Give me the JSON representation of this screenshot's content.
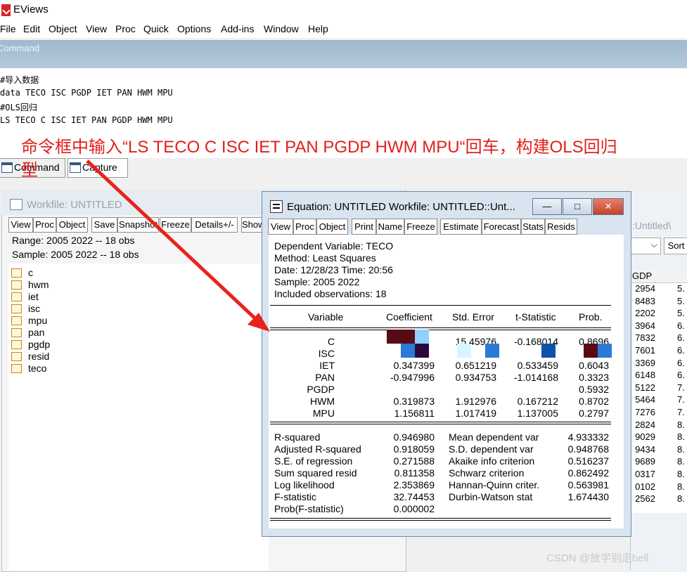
{
  "app": {
    "title": "EViews"
  },
  "menu": [
    "File",
    "Edit",
    "Object",
    "View",
    "Proc",
    "Quick",
    "Options",
    "Add-ins",
    "Window",
    "Help"
  ],
  "command": {
    "label": "Command",
    "lines": [
      "#导入数据",
      "data TECO  ISC  PGDP IET  PAN  HWM  MPU",
      "#OLS回归",
      "LS TECO  C   ISC  IET  PAN  PGDP HWM  MPU"
    ],
    "annotation": "命令框中输入“LS TECO C ISC IET PAN PGDP HWM MPU“回车，构建OLS回归",
    "annotation_cont": "型"
  },
  "tabs": [
    "Command",
    "Capture"
  ],
  "workfile": {
    "title": "Workfile: UNTITLED",
    "toolbar": [
      "View",
      "Proc",
      "Object",
      "Save",
      "Snapshot",
      "Freeze",
      "Details+/-",
      "Show"
    ],
    "range": "Range:  2005 2022   --   18 obs",
    "sample": "Sample: 2005 2022   --   18 obs",
    "objects": [
      "c",
      "hwm",
      "iet",
      "isc",
      "mpu",
      "pan",
      "pgdp",
      "resid",
      "teco"
    ]
  },
  "sheet": {
    "crumb": ":Untitled\\",
    "sort_label": "Sort",
    "col_header": "GDP",
    "col_a": [
      "2954",
      "8483",
      "2202",
      "3964",
      "7832",
      "7601",
      "3369",
      "6148",
      "5122",
      "5464",
      "7276",
      "2824",
      "9029",
      "9434",
      "9689",
      "0317",
      "0102",
      "2562"
    ],
    "col_b": [
      "5.",
      "5.",
      "5.",
      "6.",
      "6.",
      "6.",
      "6.",
      "6.",
      "7.",
      "7.",
      "7.",
      "8.",
      "8.",
      "8.",
      "8.",
      "8.",
      "8.",
      "8."
    ]
  },
  "equation": {
    "title": "Equation: UNTITLED   Workfile: UNTITLED::Unt...",
    "window_buttons": {
      "minimize": "—",
      "maximize": "□",
      "close": "✕"
    },
    "toolbar": [
      "View",
      "Proc",
      "Object",
      "Print",
      "Name",
      "Freeze",
      "Estimate",
      "Forecast",
      "Stats",
      "Resids"
    ],
    "header": [
      "Dependent Variable: TECO",
      "Method: Least Squares",
      "Date: 12/28/23   Time: 20:56",
      "Sample: 2005 2022",
      "Included observations: 18"
    ],
    "columns": [
      "Variable",
      "Coefficient",
      "Std. Error",
      "t-Statistic",
      "Prob."
    ],
    "rows": [
      {
        "var": "C",
        "coef": "",
        "se": "15.45976",
        "t": "-0.168014",
        "p": "0.8696"
      },
      {
        "var": "ISC",
        "coef": "",
        "se": "",
        "t": "",
        "p": ""
      },
      {
        "var": "IET",
        "coef": "0.347399",
        "se": "0.651219",
        "t": "0.533459",
        "p": "0.6043"
      },
      {
        "var": "PAN",
        "coef": "-0.947996",
        "se": "0.934753",
        "t": "-1.014168",
        "p": "0.3323"
      },
      {
        "var": "PGDP",
        "coef": "",
        "se": "",
        "t": "",
        "p": "0.5932"
      },
      {
        "var": "HWM",
        "coef": "0.319873",
        "se": "1.912976",
        "t": "0.167212",
        "p": "0.8702"
      },
      {
        "var": "MPU",
        "coef": "1.156811",
        "se": "1.017419",
        "t": "1.137005",
        "p": "0.2797"
      }
    ],
    "stats_left": [
      {
        "label": "R-squared",
        "value": "0.946980"
      },
      {
        "label": "Adjusted R-squared",
        "value": "0.918059"
      },
      {
        "label": "S.E. of regression",
        "value": "0.271588"
      },
      {
        "label": "Sum squared resid",
        "value": "0.811358"
      },
      {
        "label": "Log likelihood",
        "value": "2.353869"
      },
      {
        "label": "F-statistic",
        "value": "32.74453"
      },
      {
        "label": "Prob(F-statistic)",
        "value": "0.000002"
      }
    ],
    "stats_right": [
      {
        "label": "Mean dependent var",
        "value": "4.933332"
      },
      {
        "label": "S.D. dependent var",
        "value": "0.948768"
      },
      {
        "label": "Akaike info criterion",
        "value": "0.516237"
      },
      {
        "label": "Schwarz criterion",
        "value": "0.862492"
      },
      {
        "label": "Hannan-Quinn criter.",
        "value": "0.563981"
      },
      {
        "label": "Durbin-Watson stat",
        "value": "1.674430"
      }
    ]
  },
  "colors": {
    "annotation": "#e0201b",
    "arrow": "#e8231d",
    "mosaic_dark": "#5a0a14",
    "mosaic_blue": "#2a7bd6",
    "mosaic_light": "#8fd0ff"
  },
  "watermark": "CSDN @放学别走bell"
}
